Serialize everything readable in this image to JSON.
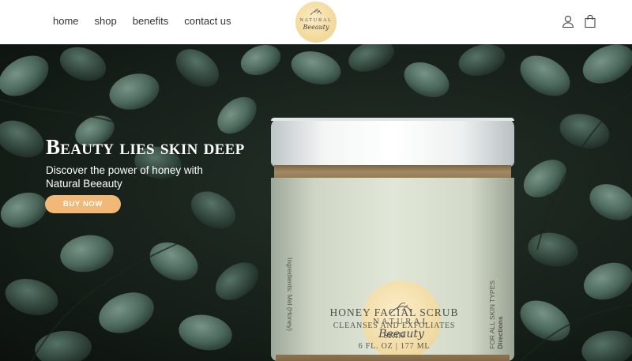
{
  "nav": {
    "items": [
      "home",
      "shop",
      "benefits",
      "contact us"
    ]
  },
  "logo": {
    "line1": "NATURAL",
    "line2": "Beeauty"
  },
  "icons": {
    "account": "user-icon",
    "cart": "shopping-bag-icon"
  },
  "hero": {
    "headline": "Beauty lies skin deep",
    "subline": "Discover the power of honey with Natural Beeauty",
    "button": "BUY NOW"
  },
  "product": {
    "badge_line1": "NATURAL",
    "badge_line2": "Beeauty",
    "title": "HONEY FACIAL SCRUB",
    "subtitle1": "CLEANSES AND EXFOLIATES",
    "subtitle2": "SKIN",
    "size": "6 FL. OZ | 177 ML",
    "side_left": "Ingredients: Mel (Honey)",
    "side_right_1": "FOR ALL SKIN TYPES",
    "side_right_2": "Directions"
  },
  "colors": {
    "button_accent": "#f1b877",
    "header_bg": "#ffffff",
    "hero_bg": "#18221b",
    "leaf_green": "#4d6b5e"
  }
}
